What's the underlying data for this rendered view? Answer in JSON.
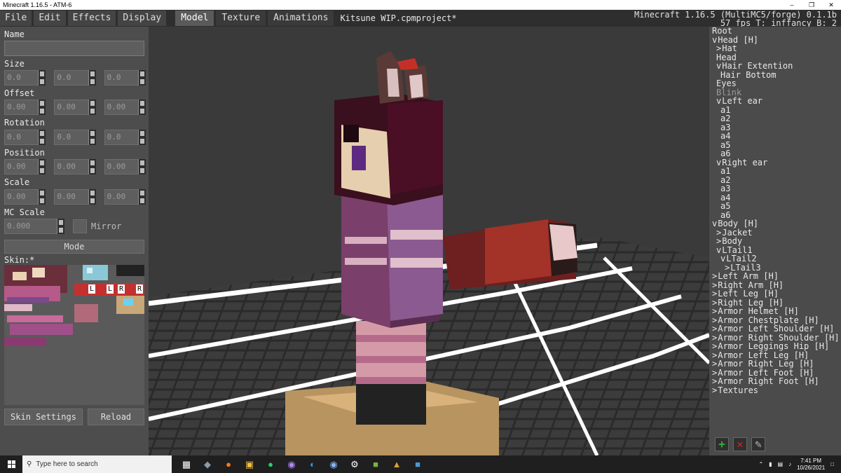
{
  "window": {
    "title": "Minecraft 1.16.5 - ATM-6",
    "minimize_glyph": "–",
    "maximize_glyph": "❐",
    "close_glyph": "✕"
  },
  "menu": {
    "items": [
      "File",
      "Edit",
      "Effects",
      "Display"
    ],
    "tabs": [
      "Model",
      "Texture",
      "Animations"
    ],
    "active_tab": "Model",
    "project_name": "Kitsune WIP.cpmproject*"
  },
  "mc_info": {
    "line1": "Minecraft 1.16.5 (MultiMC5/forge) 0.1.1b",
    "line2": "57 fps T: inffancy B: 2"
  },
  "left_panel": {
    "name_label": "Name",
    "name_value": "",
    "size_label": "Size",
    "size_values": [
      "0.0",
      "0.0",
      "0.0"
    ],
    "offset_label": "Offset",
    "offset_values": [
      "0.00",
      "0.00",
      "0.00"
    ],
    "rotation_label": "Rotation",
    "rotation_values": [
      "0.0",
      "0.0",
      "0.0"
    ],
    "position_label": "Position",
    "position_values": [
      "0.00",
      "0.00",
      "0.00"
    ],
    "scale_label": "Scale",
    "scale_values": [
      "0.00",
      "0.00",
      "0.00"
    ],
    "mc_scale_label": "MC Scale",
    "mc_scale_value": "0.000",
    "mirror_label": "Mirror",
    "mode_label": "Mode",
    "skin_label": "Skin:*",
    "skin_letters": [
      "L",
      "L",
      "R",
      "R"
    ],
    "skin_settings_label": "Skin Settings",
    "reload_label": "Reload"
  },
  "tree": {
    "nodes": [
      {
        "label": "Root",
        "indent": 0,
        "prefix": ""
      },
      {
        "label": "Head [H]",
        "indent": 0,
        "prefix": "v"
      },
      {
        "label": "Hat",
        "indent": 1,
        "prefix": ">"
      },
      {
        "label": "Head",
        "indent": 1,
        "prefix": ""
      },
      {
        "label": "Hair Extention",
        "indent": 1,
        "prefix": "v"
      },
      {
        "label": "Hair Bottom",
        "indent": 2,
        "prefix": ""
      },
      {
        "label": "Eyes",
        "indent": 1,
        "prefix": ""
      },
      {
        "label": "Blink",
        "indent": 1,
        "prefix": "",
        "dim": true
      },
      {
        "label": "Left ear",
        "indent": 1,
        "prefix": "v"
      },
      {
        "label": "a1",
        "indent": 2,
        "prefix": ""
      },
      {
        "label": "a2",
        "indent": 2,
        "prefix": ""
      },
      {
        "label": "a3",
        "indent": 2,
        "prefix": ""
      },
      {
        "label": "a4",
        "indent": 2,
        "prefix": ""
      },
      {
        "label": "a5",
        "indent": 2,
        "prefix": ""
      },
      {
        "label": "a6",
        "indent": 2,
        "prefix": ""
      },
      {
        "label": "Right ear",
        "indent": 1,
        "prefix": "v"
      },
      {
        "label": "a1",
        "indent": 2,
        "prefix": ""
      },
      {
        "label": "a2",
        "indent": 2,
        "prefix": ""
      },
      {
        "label": "a3",
        "indent": 2,
        "prefix": ""
      },
      {
        "label": "a4",
        "indent": 2,
        "prefix": ""
      },
      {
        "label": "a5",
        "indent": 2,
        "prefix": ""
      },
      {
        "label": "a6",
        "indent": 2,
        "prefix": ""
      },
      {
        "label": "Body [H]",
        "indent": 0,
        "prefix": "v"
      },
      {
        "label": "Jacket",
        "indent": 1,
        "prefix": ">"
      },
      {
        "label": "Body",
        "indent": 1,
        "prefix": ">"
      },
      {
        "label": "LTail1",
        "indent": 1,
        "prefix": "v"
      },
      {
        "label": "LTail2",
        "indent": 2,
        "prefix": "v"
      },
      {
        "label": "LTail3",
        "indent": 3,
        "prefix": ">"
      },
      {
        "label": "Left Arm [H]",
        "indent": 0,
        "prefix": ">"
      },
      {
        "label": "Right Arm [H]",
        "indent": 0,
        "prefix": ">"
      },
      {
        "label": "Left Leg [H]",
        "indent": 0,
        "prefix": ">"
      },
      {
        "label": "Right Leg [H]",
        "indent": 0,
        "prefix": ">"
      },
      {
        "label": "Armor Helmet [H]",
        "indent": 0,
        "prefix": ">"
      },
      {
        "label": "Armor Chestplate [H]",
        "indent": 0,
        "prefix": ">"
      },
      {
        "label": "Armor Left Shoulder [H]",
        "indent": 0,
        "prefix": ">"
      },
      {
        "label": "Armor Right Shoulder [H]",
        "indent": 0,
        "prefix": ">"
      },
      {
        "label": "Armor Leggings Hip [H]",
        "indent": 0,
        "prefix": ">"
      },
      {
        "label": "Armor Left Leg [H]",
        "indent": 0,
        "prefix": ">"
      },
      {
        "label": "Armor Right Leg [H]",
        "indent": 0,
        "prefix": ">"
      },
      {
        "label": "Armor Left Foot [H]",
        "indent": 0,
        "prefix": ">"
      },
      {
        "label": "Armor Right Foot [H]",
        "indent": 0,
        "prefix": ">"
      },
      {
        "label": "Textures",
        "indent": 0,
        "prefix": ">"
      }
    ],
    "add_icon": "+",
    "delete_icon": "✕",
    "edit_icon": "✎"
  },
  "taskbar": {
    "search_placeholder": "Type here to search",
    "time": "7:41 PM",
    "date": "10/26/2021"
  },
  "colors": {
    "accent_green": "#2db52d",
    "accent_red": "#d02222"
  }
}
